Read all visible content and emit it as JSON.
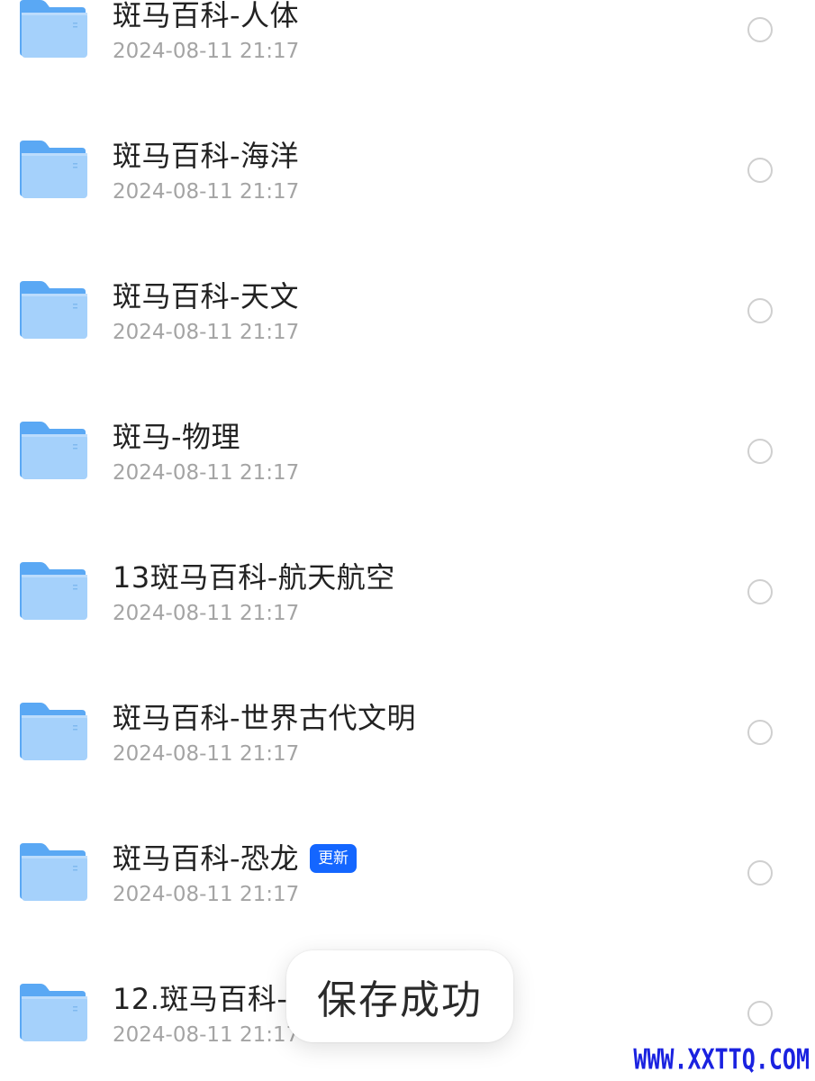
{
  "files": [
    {
      "name": "斑马百科-人体",
      "date": "2024-08-11 21:17",
      "badge": ""
    },
    {
      "name": "斑马百科-海洋",
      "date": "2024-08-11 21:17",
      "badge": ""
    },
    {
      "name": "斑马百科-天文",
      "date": "2024-08-11 21:17",
      "badge": ""
    },
    {
      "name": "斑马-物理",
      "date": "2024-08-11 21:17",
      "badge": ""
    },
    {
      "name": "13斑马百科-航天航空",
      "date": "2024-08-11 21:17",
      "badge": ""
    },
    {
      "name": "斑马百科-世界古代文明",
      "date": "2024-08-11 21:17",
      "badge": ""
    },
    {
      "name": "斑马百科-恐龙",
      "date": "2024-08-11 21:17",
      "badge": "更新"
    },
    {
      "name": "12.斑马百科-揭",
      "date": "2024-08-11 21:17",
      "badge": ""
    }
  ],
  "toast": {
    "message": "保存成功"
  },
  "watermark": "WWW.XXTTQ.COM",
  "colors": {
    "folder": "#63aef6",
    "badge": "#1466ff",
    "watermark": "#1a22e0"
  },
  "icons": {
    "folder": "folder-icon",
    "select": "radio-circle-icon"
  }
}
